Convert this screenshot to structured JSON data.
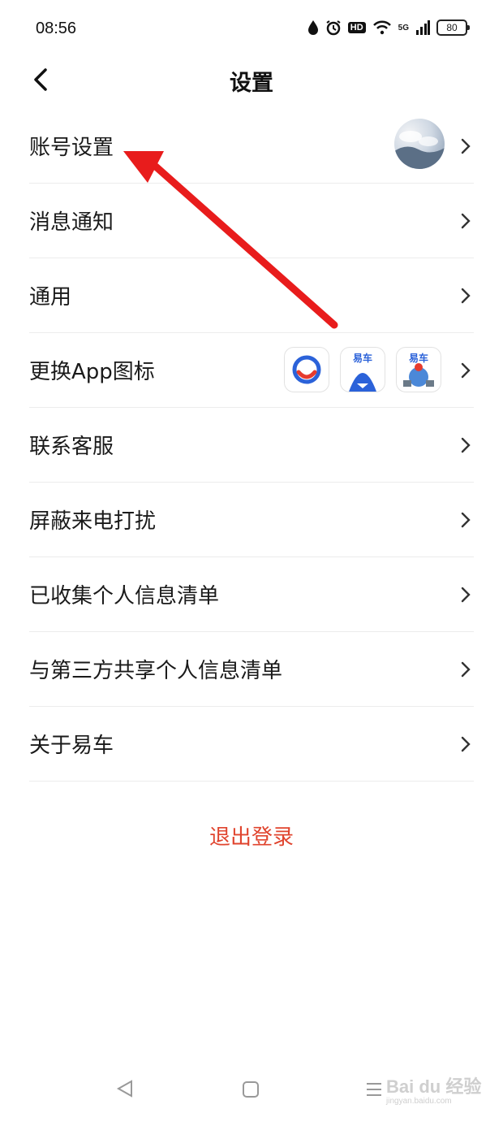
{
  "status_bar": {
    "time": "08:56",
    "network": "5G",
    "hd_label": "HD",
    "battery": "80"
  },
  "header": {
    "title": "设置",
    "back_icon": "chevron-left-icon"
  },
  "settings": {
    "items": [
      {
        "label": "账号设置"
      },
      {
        "label": "消息通知"
      },
      {
        "label": "通用"
      },
      {
        "label": "更换App图标"
      },
      {
        "label": "联系客服"
      },
      {
        "label": "屏蔽来电打扰"
      },
      {
        "label": "已收集个人信息清单"
      },
      {
        "label": "与第三方共享个人信息清单"
      },
      {
        "label": "关于易车"
      }
    ],
    "app_icon_options": [
      {
        "icon": "yiche-logo-icon",
        "brand": ""
      },
      {
        "icon": "yiche-shark-icon",
        "brand": "易车"
      },
      {
        "icon": "yiche-festival-icon",
        "brand": "易车"
      }
    ]
  },
  "logout_label": "退出登录",
  "watermark": {
    "text": "Bai du 经验",
    "sub": "jingyan.baidu.com"
  },
  "colors": {
    "accent": "#e0442e",
    "arrow": "#e81c1c",
    "divider": "#ececec"
  }
}
